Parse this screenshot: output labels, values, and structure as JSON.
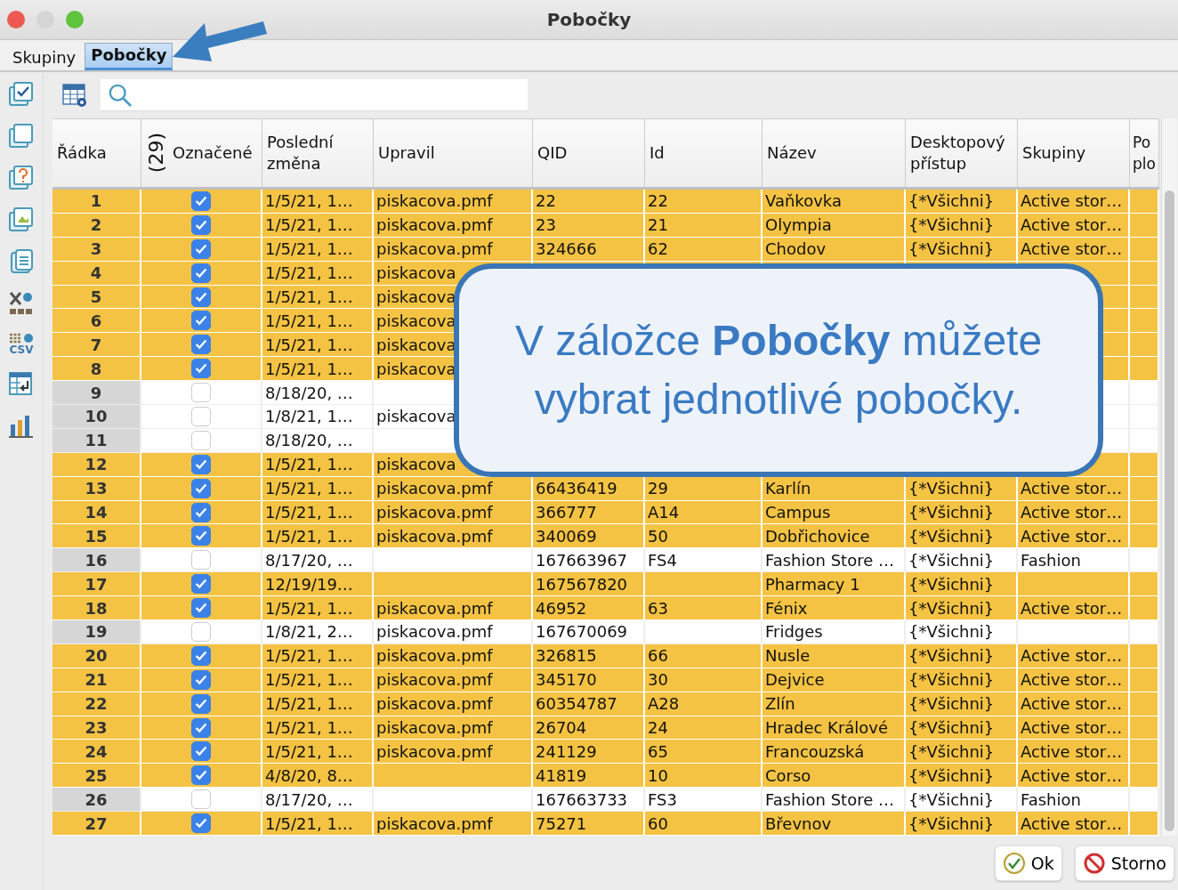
{
  "window": {
    "title": "Pobočky"
  },
  "tabs": [
    {
      "label": "Skupiny",
      "selected": false
    },
    {
      "label": "Pobočky",
      "selected": true
    }
  ],
  "sidebar": {
    "tools": [
      {
        "kind": "check-all"
      },
      {
        "kind": "uncheck-all"
      },
      {
        "kind": "query"
      },
      {
        "kind": "image"
      },
      {
        "kind": "document"
      },
      {
        "kind": "excel"
      },
      {
        "kind": "csv",
        "label": "CSV"
      },
      {
        "kind": "table-transfer"
      },
      {
        "kind": "chart"
      }
    ]
  },
  "table": {
    "marked_count": "(29)",
    "columns": [
      "Řádka",
      "Označené",
      "Poslední změna",
      "Upravil",
      "QID",
      "Id",
      "Název",
      "Desktopový přístup",
      "Skupiny",
      "Po plo"
    ],
    "rows": [
      {
        "row": "1",
        "marked": true,
        "last_change": "1/5/21, 1…",
        "edited_by": "piskacova.pmf",
        "qid": "22",
        "id": "22",
        "name": "Vaňkovka",
        "desktop_access": "{*Všichni}",
        "groups": "Active stor…"
      },
      {
        "row": "2",
        "marked": true,
        "last_change": "1/5/21, 1…",
        "edited_by": "piskacova.pmf",
        "qid": "23",
        "id": "21",
        "name": "Olympia",
        "desktop_access": "{*Všichni}",
        "groups": "Active stor…"
      },
      {
        "row": "3",
        "marked": true,
        "last_change": "1/5/21, 1…",
        "edited_by": "piskacova.pmf",
        "qid": "324666",
        "id": "62",
        "name": "Chodov",
        "desktop_access": "{*Všichni}",
        "groups": "Active stor…"
      },
      {
        "row": "4",
        "marked": true,
        "last_change": "1/5/21, 1…",
        "edited_by": "piskacova"
      },
      {
        "row": "5",
        "marked": true,
        "last_change": "1/5/21, 1…",
        "edited_by": "piskacova"
      },
      {
        "row": "6",
        "marked": true,
        "last_change": "1/5/21, 1…",
        "edited_by": "piskacova"
      },
      {
        "row": "7",
        "marked": true,
        "last_change": "1/5/21, 1…",
        "edited_by": "piskacova"
      },
      {
        "row": "8",
        "marked": true,
        "last_change": "1/5/21, 1…",
        "edited_by": "piskacova"
      },
      {
        "row": "9",
        "marked": false,
        "last_change": "8/18/20, …"
      },
      {
        "row": "10",
        "marked": false,
        "last_change": "1/8/21, 1…",
        "edited_by": "piskacova"
      },
      {
        "row": "11",
        "marked": false,
        "last_change": "8/18/20, …"
      },
      {
        "row": "12",
        "marked": true,
        "last_change": "1/5/21, 1…",
        "edited_by": "piskacova"
      },
      {
        "row": "13",
        "marked": true,
        "last_change": "1/5/21, 1…",
        "edited_by": "piskacova.pmf",
        "qid": "66436419",
        "id": "29",
        "name": "Karlín",
        "desktop_access": "{*Všichni}",
        "groups": "Active stor…"
      },
      {
        "row": "14",
        "marked": true,
        "last_change": "1/5/21, 1…",
        "edited_by": "piskacova.pmf",
        "qid": "366777",
        "id": "A14",
        "name": "Campus",
        "desktop_access": "{*Všichni}",
        "groups": "Active stor…"
      },
      {
        "row": "15",
        "marked": true,
        "last_change": "1/5/21, 1…",
        "edited_by": "piskacova.pmf",
        "qid": "340069",
        "id": "50",
        "name": "Dobřichovice",
        "desktop_access": "{*Všichni}",
        "groups": "Active stor…"
      },
      {
        "row": "16",
        "marked": false,
        "last_change": "8/17/20, …",
        "qid": "167663967",
        "id": "FS4",
        "name": "Fashion Store …",
        "desktop_access": "{*Všichni}",
        "groups": "Fashion"
      },
      {
        "row": "17",
        "marked": true,
        "last_change": "12/19/19…",
        "qid": "167567820",
        "name": "Pharmacy 1",
        "desktop_access": "{*Všichni}"
      },
      {
        "row": "18",
        "marked": true,
        "last_change": "1/5/21, 1…",
        "edited_by": "piskacova.pmf",
        "qid": "46952",
        "id": "63",
        "name": "Fénix",
        "desktop_access": "{*Všichni}",
        "groups": "Active stor…"
      },
      {
        "row": "19",
        "marked": false,
        "last_change": "1/8/21, 2…",
        "edited_by": "piskacova.pmf",
        "qid": "167670069",
        "name": "Fridges",
        "desktop_access": "{*Všichni}"
      },
      {
        "row": "20",
        "marked": true,
        "last_change": "1/5/21, 1…",
        "edited_by": "piskacova.pmf",
        "qid": "326815",
        "id": "66",
        "name": "Nusle",
        "desktop_access": "{*Všichni}",
        "groups": "Active stor…"
      },
      {
        "row": "21",
        "marked": true,
        "last_change": "1/5/21, 1…",
        "edited_by": "piskacova.pmf",
        "qid": "345170",
        "id": "30",
        "name": "Dejvice",
        "desktop_access": "{*Všichni}",
        "groups": "Active stor…"
      },
      {
        "row": "22",
        "marked": true,
        "last_change": "1/5/21, 1…",
        "edited_by": "piskacova.pmf",
        "qid": "60354787",
        "id": "A28",
        "name": "Zlín",
        "desktop_access": "{*Všichni}",
        "groups": "Active stor…"
      },
      {
        "row": "23",
        "marked": true,
        "last_change": "1/5/21, 1…",
        "edited_by": "piskacova.pmf",
        "qid": "26704",
        "id": "24",
        "name": "Hradec Králové",
        "desktop_access": "{*Všichni}",
        "groups": "Active stor…"
      },
      {
        "row": "24",
        "marked": true,
        "last_change": "1/5/21, 1…",
        "edited_by": "piskacova.pmf",
        "qid": "241129",
        "id": "65",
        "name": "Francouzská",
        "desktop_access": "{*Všichni}",
        "groups": "Active stor…"
      },
      {
        "row": "25",
        "marked": true,
        "last_change": "4/8/20, 8…",
        "qid": "41819",
        "id": "10",
        "name": "Corso",
        "desktop_access": "{*Všichni}",
        "groups": "Active stor…"
      },
      {
        "row": "26",
        "marked": false,
        "last_change": "8/17/20, …",
        "qid": "167663733",
        "id": "FS3",
        "name": "Fashion Store …",
        "desktop_access": "{*Všichni}",
        "groups": "Fashion"
      },
      {
        "row": "27",
        "marked": true,
        "last_change": "1/5/21, 1…",
        "edited_by": "piskacova.pmf",
        "qid": "75271",
        "id": "60",
        "name": "Břevnov",
        "desktop_access": "{*Všichni}",
        "groups": "Active stor…"
      }
    ]
  },
  "callout": {
    "text": "V záložce **Pobočky** můžete vybrat jednotlivé pobočky."
  },
  "buttons": [
    {
      "kind": "ok",
      "label": "Ok"
    },
    {
      "kind": "cancel",
      "label": "Storno"
    }
  ]
}
